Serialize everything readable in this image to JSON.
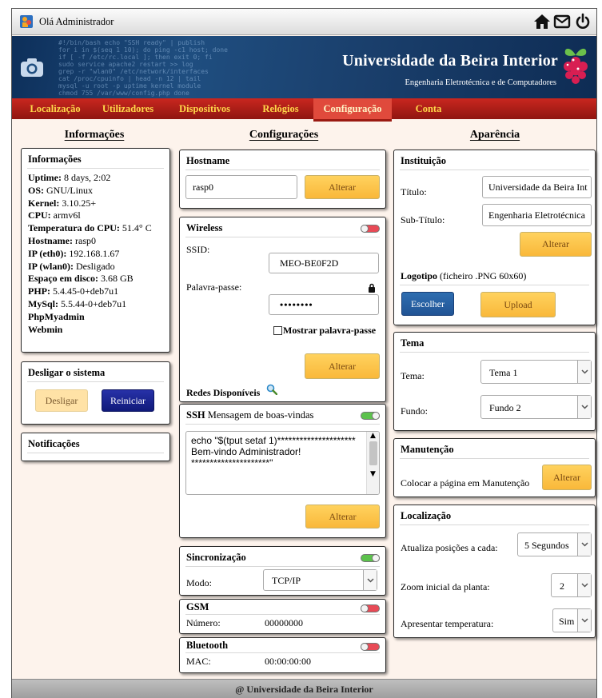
{
  "topbar": {
    "greeting": "Olá Administrador",
    "icons": [
      "home-icon",
      "mail-icon",
      "power-icon"
    ]
  },
  "banner": {
    "title": "Universidade da Beira Interior",
    "subtitle": "Engenharia Eletrotécnica e de Computadores"
  },
  "nav": {
    "tabs": [
      "Localização",
      "Utilizadores",
      "Dispositivos",
      "Relógios",
      "Configuração",
      "Conta"
    ],
    "active": "Configuração"
  },
  "columns": {
    "left": "Informações",
    "middle": "Configurações",
    "right": "Aparência"
  },
  "info": {
    "title": "Informações",
    "lines": [
      {
        "k": "Uptime:",
        "v": " 8 days, 2:02"
      },
      {
        "k": "OS:",
        "v": " GNU/Linux"
      },
      {
        "k": "Kernel:",
        "v": " 3.10.25+"
      },
      {
        "k": "CPU:",
        "v": " armv6l"
      },
      {
        "k": "Temperatura do CPU:",
        "v": " 51.4° C"
      },
      {
        "k": "Hostname:",
        "v": " rasp0"
      },
      {
        "k": "IP (eth0):",
        "v": " 192.168.1.67"
      },
      {
        "k": "IP (wlan0):",
        "v": " Desligado"
      },
      {
        "k": "Espaço em disco:",
        "v": " 3.68 GB"
      },
      {
        "k": "PHP:",
        "v": " 5.4.45-0+deb7u1"
      },
      {
        "k": "MySql:",
        "v": " 5.5.44-0+deb7u1"
      },
      {
        "k": "PhpMyadmin",
        "v": ""
      },
      {
        "k": "Webmin",
        "v": ""
      }
    ]
  },
  "shutdown": {
    "title": "Desligar o sistema",
    "off_label": "Desligar",
    "restart_label": "Reiniciar"
  },
  "notifications": {
    "title": "Notificações"
  },
  "hostname": {
    "title": "Hostname",
    "value": "rasp0",
    "button": "Alterar"
  },
  "wireless": {
    "title": "Wireless",
    "enabled": false,
    "ssid_label": "SSID:",
    "ssid": "MEO-BE0F2D",
    "pass_label": "Palavra-passe:",
    "pass": "••••••••",
    "show_label": "Mostrar palavra-passe",
    "button": "Alterar",
    "networks_label": "Redes Disponíveis"
  },
  "ssh": {
    "title_bold": "SSH",
    "title_rest": " Mensagem de boas-vindas",
    "enabled": true,
    "message": "echo \"$(tput setaf 1)*********************\nBem-vindo Administrador!\n*********************\"",
    "button": "Alterar"
  },
  "sync": {
    "title": "Sincronização",
    "enabled": true,
    "mode_label": "Modo:",
    "mode": "TCP/IP"
  },
  "gsm": {
    "title": "GSM",
    "enabled": false,
    "number_label": "Número:",
    "number": "00000000"
  },
  "bluetooth": {
    "title": "Bluetooth",
    "enabled": false,
    "mac_label": "MAC:",
    "mac": "00:00:00:00"
  },
  "institution": {
    "title": "Instituição",
    "title_label": "Título:",
    "title_value": "Universidade da Beira Int",
    "subtitle_label": "Sub-Título:",
    "subtitle_value": "Engenharia Eletrotécnica",
    "button": "Alterar",
    "logo_bold": "Logotipo",
    "logo_rest": " (ficheiro .PNG 60x60)",
    "choose": "Escolher",
    "upload": "Upload"
  },
  "theme": {
    "title": "Tema",
    "theme_label": "Tema:",
    "theme_value": "Tema 1",
    "bg_label": "Fundo:",
    "bg_value": "Fundo 2"
  },
  "maintenance": {
    "title": "Manutenção",
    "label": "Colocar a página em Manutenção",
    "button": "Alterar"
  },
  "location": {
    "title": "Localização",
    "refresh_label": "Atualiza posições a cada:",
    "refresh_value": "5 Segundos",
    "zoom_label": "Zoom inicial da planta:",
    "zoom_value": "2",
    "temp_label": "Apresentar temperatura:",
    "temp_value": "Sim"
  },
  "footer": {
    "text": "@ Universidade da Beira Interior"
  },
  "colors": {
    "nav_red": "#b01e16",
    "tab_text": "#ffd84a",
    "button_orange": "#fbbd43",
    "banner_blue": "#1f4e80"
  }
}
